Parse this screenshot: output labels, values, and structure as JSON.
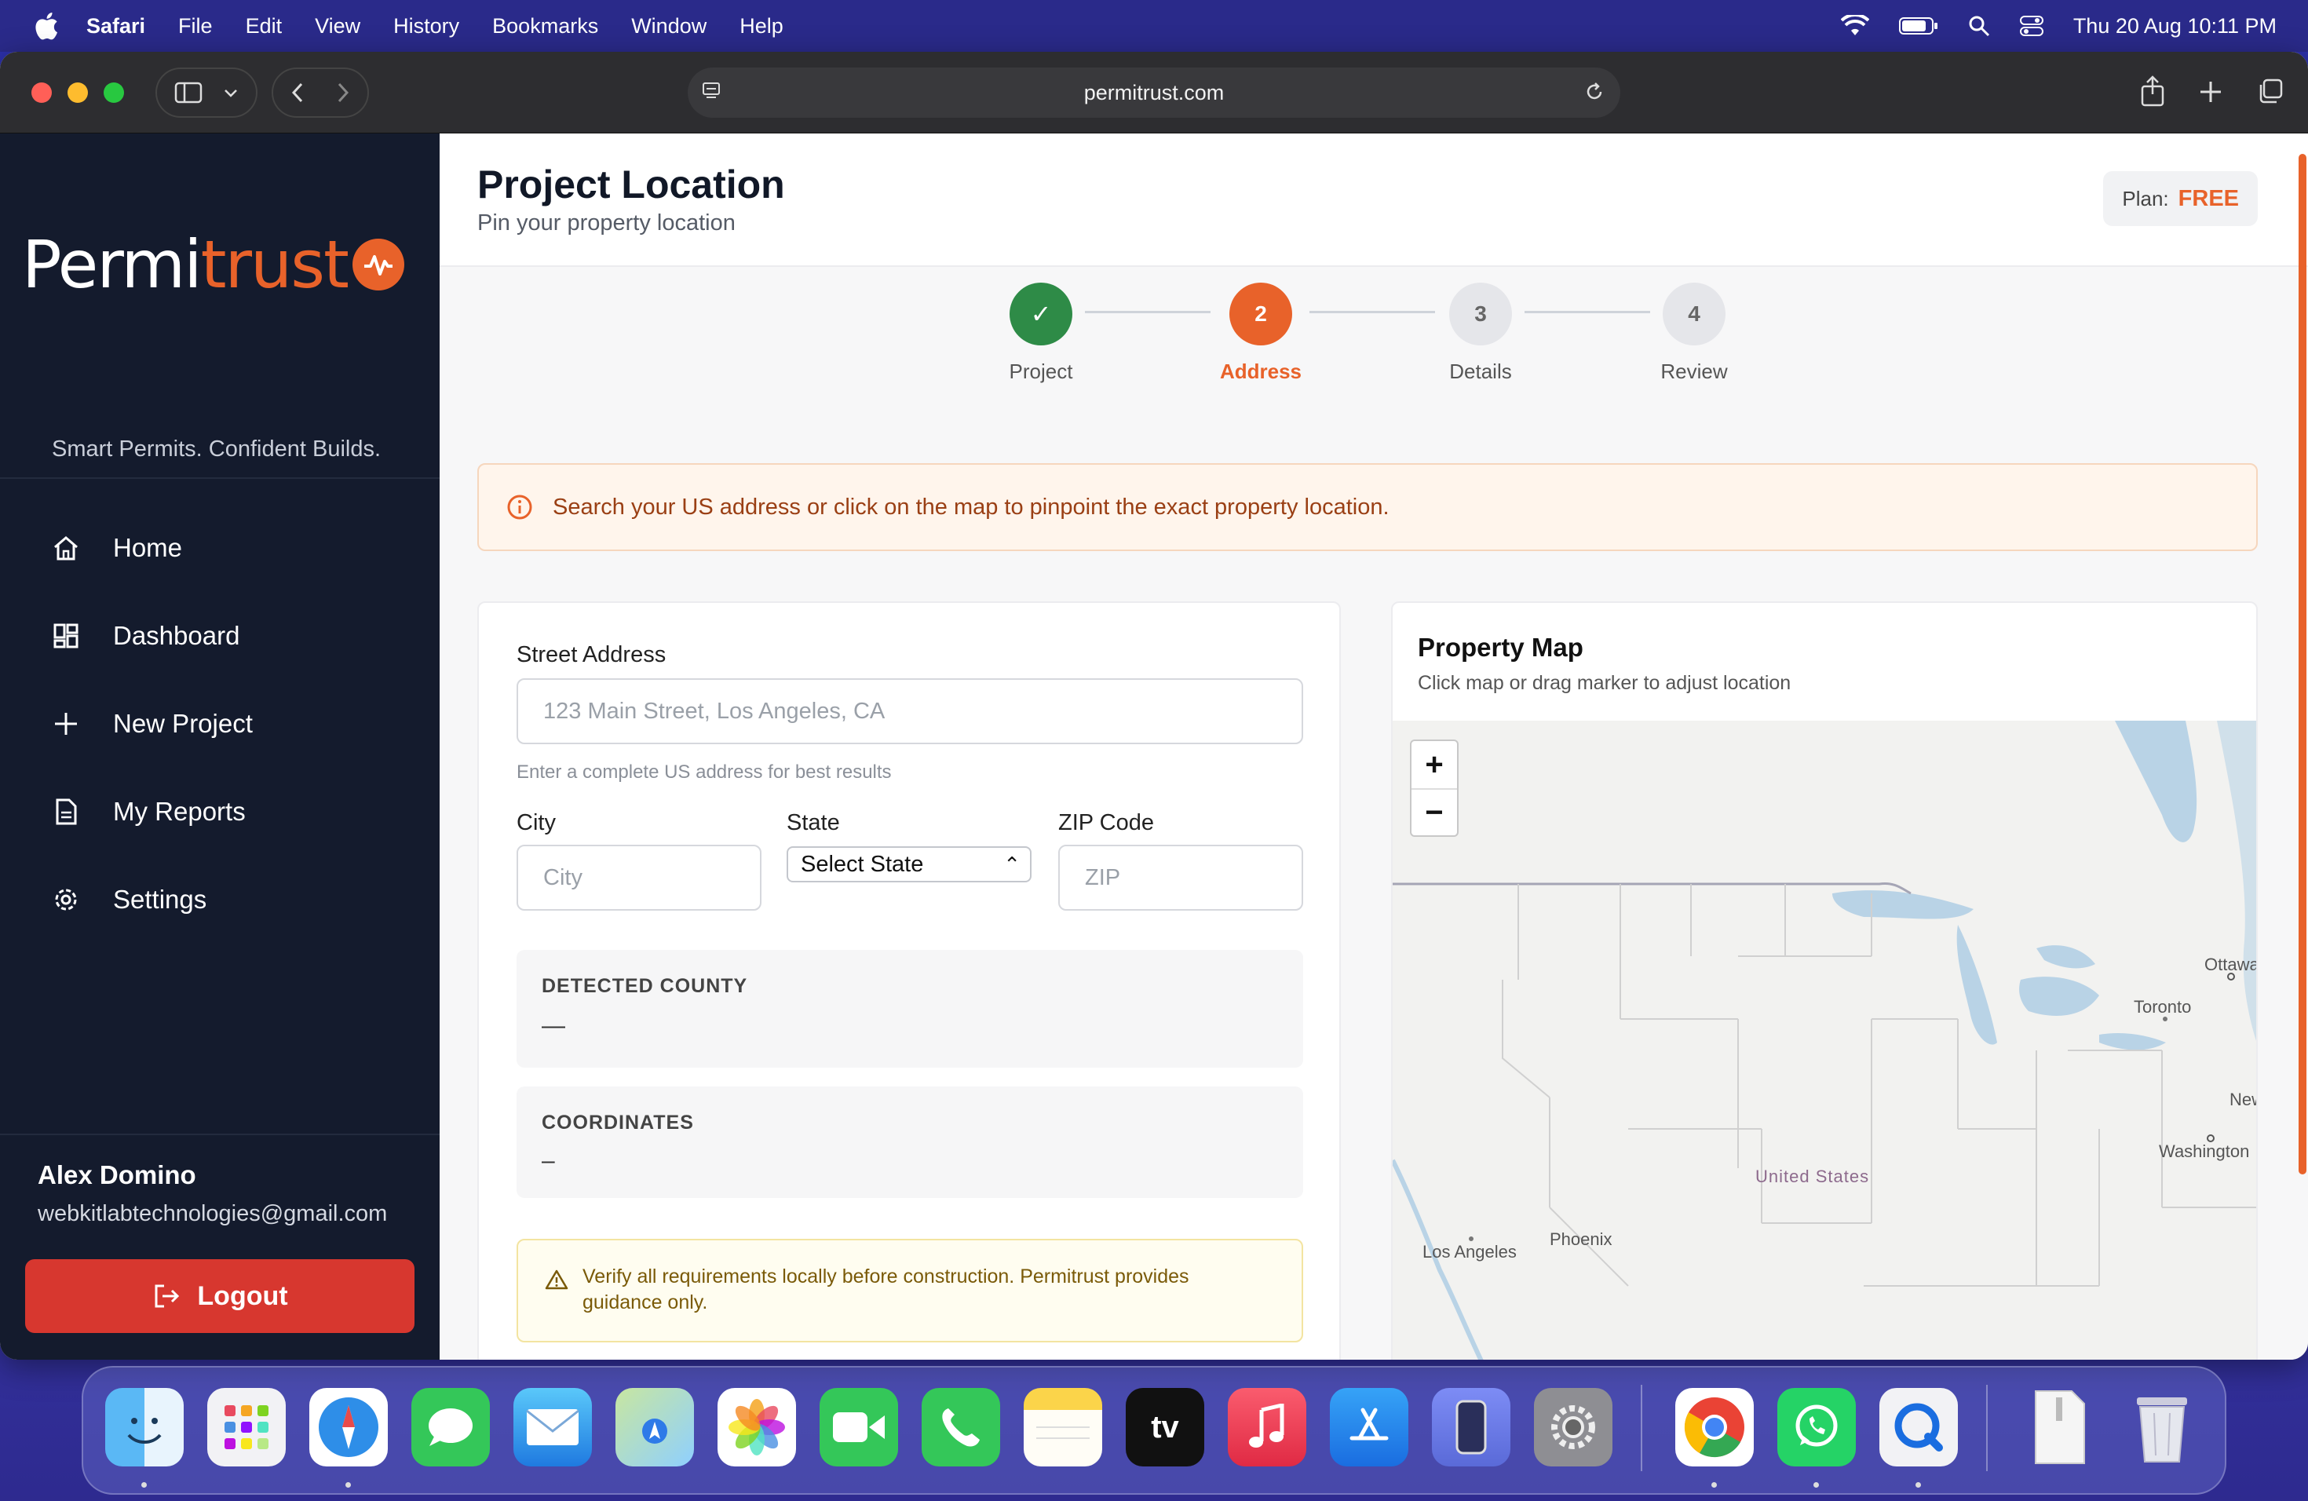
{
  "menubar": {
    "app": "Safari",
    "items": [
      "File",
      "Edit",
      "View",
      "History",
      "Bookmarks",
      "Window",
      "Help"
    ],
    "datetime": "Thu 20 Aug  10:11 PM"
  },
  "browser": {
    "url": "permitrust.com"
  },
  "sidebar": {
    "logo_white": "Permi",
    "logo_orange": "trust",
    "tagline": "Smart Permits. Confident Builds.",
    "nav": [
      {
        "label": "Home",
        "icon": "home-icon"
      },
      {
        "label": "Dashboard",
        "icon": "dashboard-icon"
      },
      {
        "label": "New Project",
        "icon": "plus-icon"
      },
      {
        "label": "My Reports",
        "icon": "document-icon"
      },
      {
        "label": "Settings",
        "icon": "gear-icon"
      }
    ],
    "user": {
      "name": "Alex Domino",
      "email": "webkitlabtechnologies@gmail.com"
    },
    "logout_label": "Logout"
  },
  "header": {
    "title": "Project Location",
    "subtitle": "Pin your property location",
    "plan_label": "Plan:",
    "plan_value": "FREE"
  },
  "stepper": {
    "steps": [
      {
        "number": "✓",
        "label": "Project",
        "state": "complete"
      },
      {
        "number": "2",
        "label": "Address",
        "state": "active"
      },
      {
        "number": "3",
        "label": "Details",
        "state": "pending"
      },
      {
        "number": "4",
        "label": "Review",
        "state": "pending"
      }
    ]
  },
  "info_banner": "Search your US address or click on the map to pinpoint the exact property location.",
  "form": {
    "street_label": "Street Address",
    "street_placeholder": "123 Main Street, Los Angeles, CA",
    "street_hint": "Enter a complete US address for best results",
    "city_label": "City",
    "city_placeholder": "City",
    "state_label": "State",
    "state_value": "Select State",
    "zip_label": "ZIP Code",
    "zip_placeholder": "ZIP",
    "county_title": "DETECTED COUNTY",
    "county_value": "—",
    "coords_title": "COORDINATES",
    "coords_value": "–",
    "warning": "Verify all requirements locally before construction. Permitrust provides guidance only."
  },
  "map": {
    "title": "Property Map",
    "subtitle": "Click map or drag marker to adjust location",
    "zoom_in": "+",
    "zoom_out": "−",
    "labels": {
      "ottawa": "Ottawa",
      "toronto": "Toronto",
      "new": "New",
      "washington": "Washington",
      "united_states": "United States",
      "phoenix": "Phoenix",
      "los_angeles": "Los Angeles"
    }
  },
  "dock": {
    "apps": [
      "Finder",
      "Launchpad",
      "Safari",
      "Messages",
      "Mail",
      "Maps",
      "Photos",
      "FaceTime",
      "Phone",
      "Notes",
      "TV",
      "Music",
      "App Store",
      "iPhone Mirroring",
      "System Settings",
      "Chrome",
      "WhatsApp",
      "QuickTime",
      "Archive",
      "Trash"
    ]
  },
  "colors": {
    "brand_orange": "#e8622a",
    "sidebar_bg": "#141b2d",
    "success_green": "#2e8b47",
    "logout_red": "#d7372f"
  }
}
